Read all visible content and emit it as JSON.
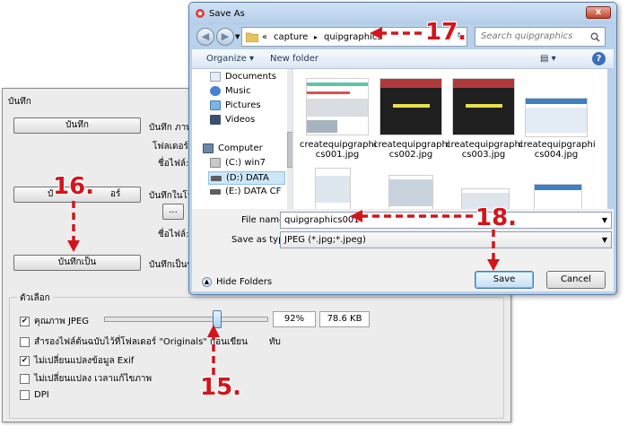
{
  "background_dialog": {
    "title": "บันทึก",
    "save_button": "บันทึก",
    "save_to_folder_button": "บันทึกในโฟลเดอร์",
    "save_to_folder_button_visible": "บั",
    "save_to_folder_button_tail": "อร์",
    "save_as_button": "บันทึกเป็น",
    "save_label_1": "บันทึก  ภาพ",
    "folder_label": "โฟลเดอร์:",
    "filename_label": "ชื่อไฟล์:",
    "save_in_folder_label": "บันทึกในโฟล",
    "filename_label_2": "ชื่อไฟล์:",
    "save_as_label": "บันทึกเป็นชื่",
    "browse_button": "...",
    "options": {
      "title": "ตัวเลือก",
      "jpeg_quality": {
        "label": "คุณภาพ JPEG",
        "checked": true,
        "level": 0.7,
        "percent": "92%",
        "size": "78.6 KB"
      },
      "backup_originals": {
        "label": "สำรองไฟล์ต้นฉบับไว้ที่โฟลเดอร์ \"Originals\" ก่อนเขียน",
        "tail": "ทับ",
        "checked": false
      },
      "keep_exif": {
        "label": "ไม่เปลี่ยนแปลงข้อมูล Exif",
        "checked": true
      },
      "keep_modified_time": {
        "label": "ไม่เปลี่ยนแปลง เวลาแก้ไขภาพ",
        "checked": false
      },
      "dpi": {
        "label": "DPI",
        "checked": false
      }
    }
  },
  "save_dialog": {
    "title": "Save As",
    "close": "x",
    "breadcrumb": {
      "prefix": "«",
      "parts": [
        "capture",
        "quipgraphics"
      ],
      "separator": "▸"
    },
    "refresh": "↻",
    "search_placeholder": "Search quipgraphics",
    "toolbar": {
      "organize": "Organize ▾",
      "new_folder": "New folder",
      "help": "?"
    },
    "nav_items": [
      "Documents",
      "Music",
      "Pictures",
      "Videos",
      "Computer",
      "(C:) win7",
      "(D:) DATA",
      "(E:) DATA CF"
    ],
    "files": [
      {
        "name": "createquipgraphics001.jpg",
        "line1": "createquipgraphi",
        "line2": "cs001.jpg"
      },
      {
        "name": "createquipgraphics002.jpg",
        "line1": "createquipgraphi",
        "line2": "cs002.jpg"
      },
      {
        "name": "createquipgraphics003.jpg",
        "line1": "createquipgraphi",
        "line2": "cs003.jpg"
      },
      {
        "name": "createquipgraphics004.jpg",
        "line1": "createquipgraphi",
        "line2": "cs004.jpg"
      }
    ],
    "file_name_label": "File name:",
    "file_name_value": "quipgraphics001",
    "save_type_label": "Save as type:",
    "save_type_value": "JPEG (*.jpg;*.jpeg)",
    "hide_folders": "Hide Folders",
    "save_button": "Save",
    "cancel_button": "Cancel"
  },
  "annotations": {
    "n15": "15.",
    "n16": "16.",
    "n17": "17.",
    "n18": "18."
  },
  "colors": {
    "annotation": "#d2151b",
    "accent": "#3c7fb1"
  }
}
